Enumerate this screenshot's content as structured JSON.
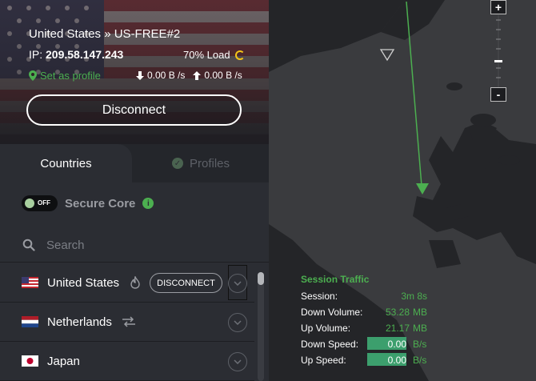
{
  "connection": {
    "server_name": "United States » US-FREE#2",
    "ip_label": "IP:",
    "ip_value": "209.58.147.243",
    "load": "70% Load",
    "set_profile": "Set as profile",
    "down_speed": "0.00 B /s",
    "up_speed": "0.00 B /s",
    "disconnect_label": "Disconnect"
  },
  "tabs": {
    "countries": "Countries",
    "profiles": "Profiles"
  },
  "secure_core": {
    "toggle_label": "OFF",
    "label": "Secure Core"
  },
  "search": {
    "placeholder": "Search"
  },
  "countries": [
    {
      "name": "United States",
      "action": "DISCONNECT"
    },
    {
      "name": "Netherlands"
    },
    {
      "name": "Japan"
    }
  ],
  "map": {
    "zoom_in": "+",
    "zoom_out": "-",
    "colors": {
      "land": "#3a3b3e",
      "water": "#242528",
      "accent": "#4caf50"
    }
  },
  "session_traffic": {
    "title": "Session Traffic",
    "session_label": "Session:",
    "session_value": "3m 8s",
    "down_volume_label": "Down Volume:",
    "down_volume_value": "53.28",
    "down_volume_unit": "MB",
    "up_volume_label": "Up Volume:",
    "up_volume_value": "21.17",
    "up_volume_unit": "MB",
    "down_speed_label": "Down Speed:",
    "down_speed_value": "0.00",
    "down_speed_unit": "B/s",
    "up_speed_label": "Up Speed:",
    "up_speed_value": "0.00",
    "up_speed_unit": "B/s"
  }
}
